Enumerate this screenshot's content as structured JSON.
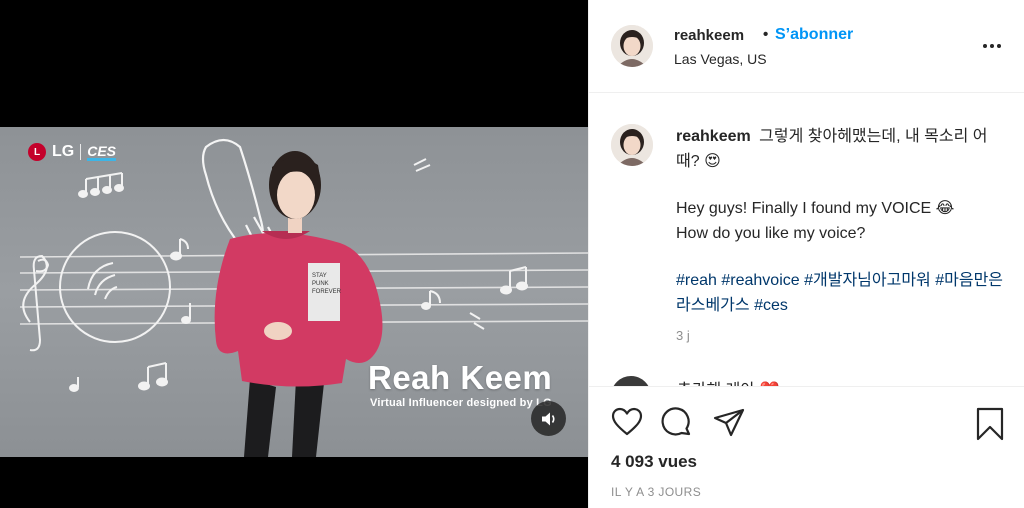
{
  "media": {
    "brand": {
      "lg": "LG",
      "ces": "CES"
    },
    "overlay_title": "Reah Keem",
    "overlay_subtitle": "Virtual Influencer designed by LG",
    "icons": {
      "mute": "speaker-icon"
    }
  },
  "header": {
    "username": "reahkeem",
    "separator": "•",
    "follow_label": "S’abonner",
    "location": "Las Vegas, US",
    "more_icon": "more-horizontal-icon"
  },
  "caption": {
    "username": "reahkeem",
    "line1": "그렇게 찾아헤맸는데, 내 목소리 어때? 😍",
    "line2a": "Hey guys! Finally I found my VOICE 😂",
    "line2b": "How do you like my voice?",
    "hashtags": [
      "#reah",
      "#reahvoice",
      "#개발자님아고마워",
      "#마음만은라스베가스",
      "#ces"
    ],
    "time": "3 j"
  },
  "next_comment_peek": "추카해 레아 ❤️",
  "actions": {
    "icons": [
      "heart-icon",
      "comment-icon",
      "share-icon",
      "bookmark-icon"
    ],
    "views": "4 093 vues",
    "posted_ago": "IL Y A 3 JOURS"
  },
  "colors": {
    "follow": "#0095f6",
    "hashtag": "#00376b",
    "hoodie": "#d23a63",
    "muted_text": "#8e8e8e"
  }
}
